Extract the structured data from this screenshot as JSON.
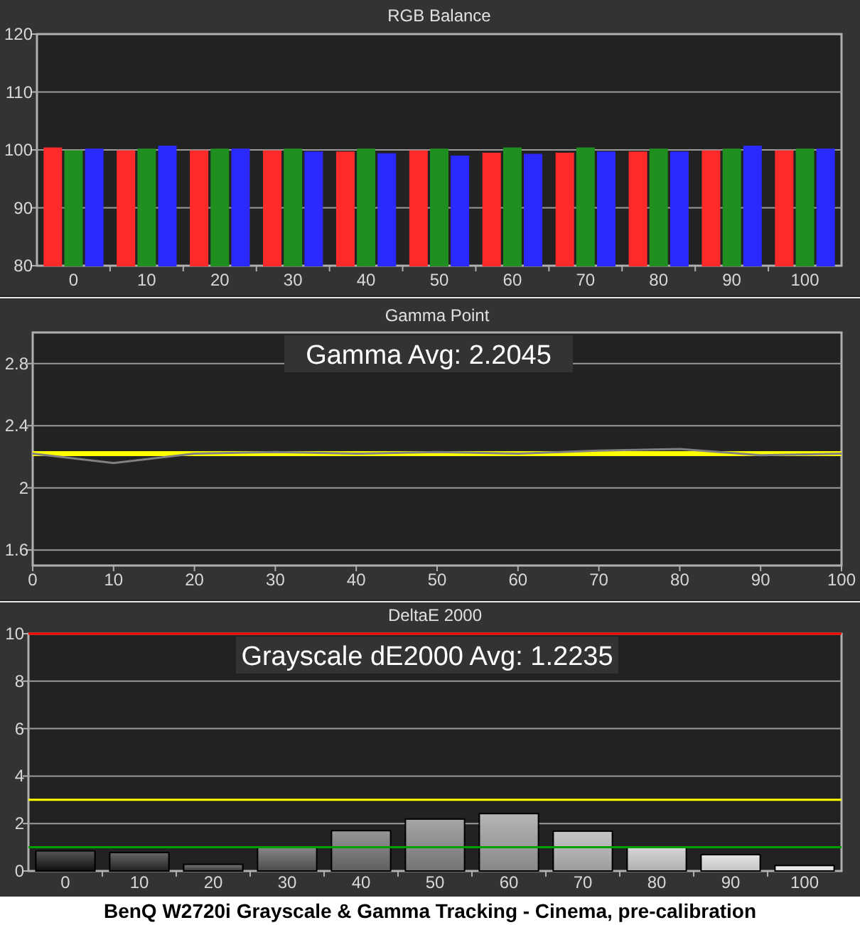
{
  "charts": [
    {
      "chart_data": {
        "type": "bar",
        "title": "RGB Balance",
        "grid": true,
        "categories": [
          "0",
          "10",
          "20",
          "30",
          "40",
          "50",
          "60",
          "70",
          "80",
          "90",
          "100"
        ],
        "ylim": [
          80,
          120
        ],
        "yticks": [
          80,
          90,
          100,
          110,
          120
        ],
        "series": [
          {
            "color": "#ff2a2a",
            "values": [
              100.3,
              99.8,
              99.8,
              99.8,
              99.6,
              99.8,
              99.4,
              99.4,
              99.6,
              99.8,
              99.8
            ]
          },
          {
            "color": "#1f8f1f",
            "values": [
              99.8,
              100.1,
              100.1,
              100.1,
              100.1,
              100.1,
              100.3,
              100.3,
              100.1,
              100.1,
              100.1
            ]
          },
          {
            "color": "#2a2aff",
            "values": [
              100.1,
              100.6,
              100.1,
              99.6,
              99.3,
              98.9,
              99.2,
              99.6,
              99.6,
              100.6,
              100.1
            ]
          }
        ]
      }
    },
    {
      "chart_data": {
        "type": "line",
        "title": "Gamma Point",
        "grid": true,
        "x": [
          0,
          10,
          20,
          30,
          40,
          50,
          60,
          70,
          80,
          90,
          100
        ],
        "xlim": [
          0,
          100
        ],
        "xticks": [
          0,
          10,
          20,
          30,
          40,
          50,
          60,
          70,
          80,
          90,
          100
        ],
        "ylim": [
          1.5,
          3.0
        ],
        "yticks": [
          1.6,
          2,
          2.4,
          2.8
        ],
        "series": [
          {
            "color": "#ffff00",
            "values": [
              2.22,
              2.22,
              2.22,
              2.22,
              2.22,
              2.22,
              2.22,
              2.22,
              2.22,
              2.22,
              2.22
            ]
          },
          {
            "color": "#808080",
            "values": [
              2.22,
              2.16,
              2.22,
              2.23,
              2.22,
              2.23,
              2.22,
              2.24,
              2.25,
              2.21,
              2.22
            ]
          }
        ],
        "annotations": [
          {
            "text": "Gamma Avg: 2.2045"
          }
        ]
      }
    },
    {
      "chart_data": {
        "type": "bar",
        "title": "DeltaE 2000",
        "grid": true,
        "categories": [
          "0",
          "10",
          "20",
          "30",
          "40",
          "50",
          "60",
          "70",
          "80",
          "90",
          "100"
        ],
        "ylim": [
          0,
          10
        ],
        "yticks": [
          0,
          2,
          4,
          6,
          8,
          10
        ],
        "series": [
          {
            "values": [
              0.85,
              0.78,
              0.28,
              0.99,
              1.7,
              2.19,
              2.42,
              1.68,
              0.99,
              0.69,
              0.23
            ]
          }
        ],
        "annotations": [
          {
            "text": "Grayscale dE2000 Avg: 1.2235"
          }
        ],
        "ref_lines": [
          {
            "axis": "y",
            "value": 10,
            "color": "#ff0000"
          },
          {
            "axis": "y",
            "value": 3,
            "color": "#ffff00"
          },
          {
            "axis": "y",
            "value": 1,
            "color": "#00a000"
          }
        ]
      }
    }
  ],
  "caption": "BenQ W2720i Grayscale & Gamma Tracking - Cinema, pre-calibration"
}
